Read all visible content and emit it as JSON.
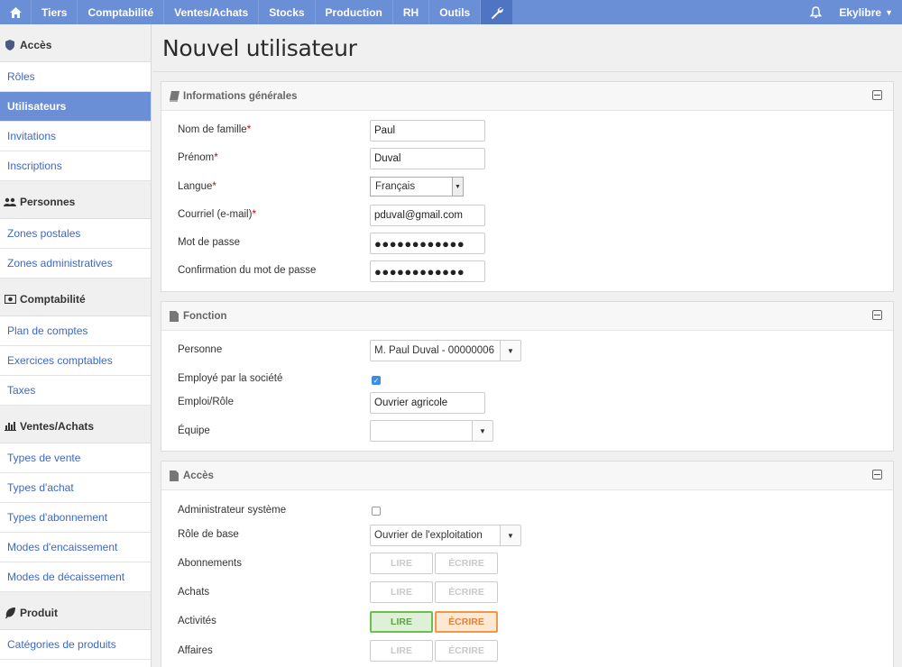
{
  "nav": {
    "items": [
      "Tiers",
      "Comptabilité",
      "Ventes/Achats",
      "Stocks",
      "Production",
      "RH",
      "Outils"
    ],
    "user": "Ekylibre"
  },
  "sidebar": {
    "sections": [
      {
        "title": "Accès",
        "icon": "shield-icon",
        "items": [
          "Rôles",
          "Utilisateurs",
          "Invitations",
          "Inscriptions"
        ],
        "active": "Utilisateurs"
      },
      {
        "title": "Personnes",
        "icon": "people-icon",
        "items": [
          "Zones postales",
          "Zones administratives"
        ]
      },
      {
        "title": "Comptabilité",
        "icon": "money-icon",
        "items": [
          "Plan de comptes",
          "Exercices comptables",
          "Taxes"
        ]
      },
      {
        "title": "Ventes/Achats",
        "icon": "bar-chart-icon",
        "items": [
          "Types de vente",
          "Types d'achat",
          "Types d'abonnement",
          "Modes d'encaissement",
          "Modes de décaissement"
        ]
      },
      {
        "title": "Produit",
        "icon": "leaf-icon",
        "items": [
          "Catégories de produits"
        ]
      }
    ]
  },
  "page": {
    "title": "Nouvel utilisateur"
  },
  "general": {
    "title": "Informations générales",
    "last_name_label": "Nom de famille",
    "last_name": "Paul",
    "first_name_label": "Prénom",
    "first_name": "Duval",
    "language_label": "Langue",
    "language": "Français",
    "email_label": "Courriel (e-mail)",
    "email": "pduval@gmail.com",
    "password_label": "Mot de passe",
    "password": "●●●●●●●●●●●●",
    "password_confirm_label": "Confirmation du mot de passe",
    "password_confirm": "●●●●●●●●●●●●",
    "required_mark": "*"
  },
  "function": {
    "title": "Fonction",
    "person_label": "Personne",
    "person": "M. Paul Duval - 00000006",
    "employed_label": "Employé par la société",
    "employed": true,
    "role_label": "Emploi/Rôle",
    "role": "Ouvrier agricole",
    "team_label": "Équipe",
    "team": ""
  },
  "access": {
    "title": "Accès",
    "admin_label": "Administrateur système",
    "admin": false,
    "base_role_label": "Rôle de base",
    "base_role": "Ouvrier de l'exploitation",
    "read_label": "LIRE",
    "write_label": "ÉCRIRE",
    "permissions": [
      {
        "name": "Abonnements",
        "read": false,
        "write": false
      },
      {
        "name": "Achats",
        "read": false,
        "write": false
      },
      {
        "name": "Activités",
        "read": true,
        "write": true
      },
      {
        "name": "Affaires",
        "read": false,
        "write": false
      }
    ]
  },
  "colors": {
    "nav": "#6b8fd6",
    "nav_active": "#4f74c2",
    "link": "#3d68c4",
    "read_on": "#6cbf4d",
    "write_on": "#f0984a"
  }
}
